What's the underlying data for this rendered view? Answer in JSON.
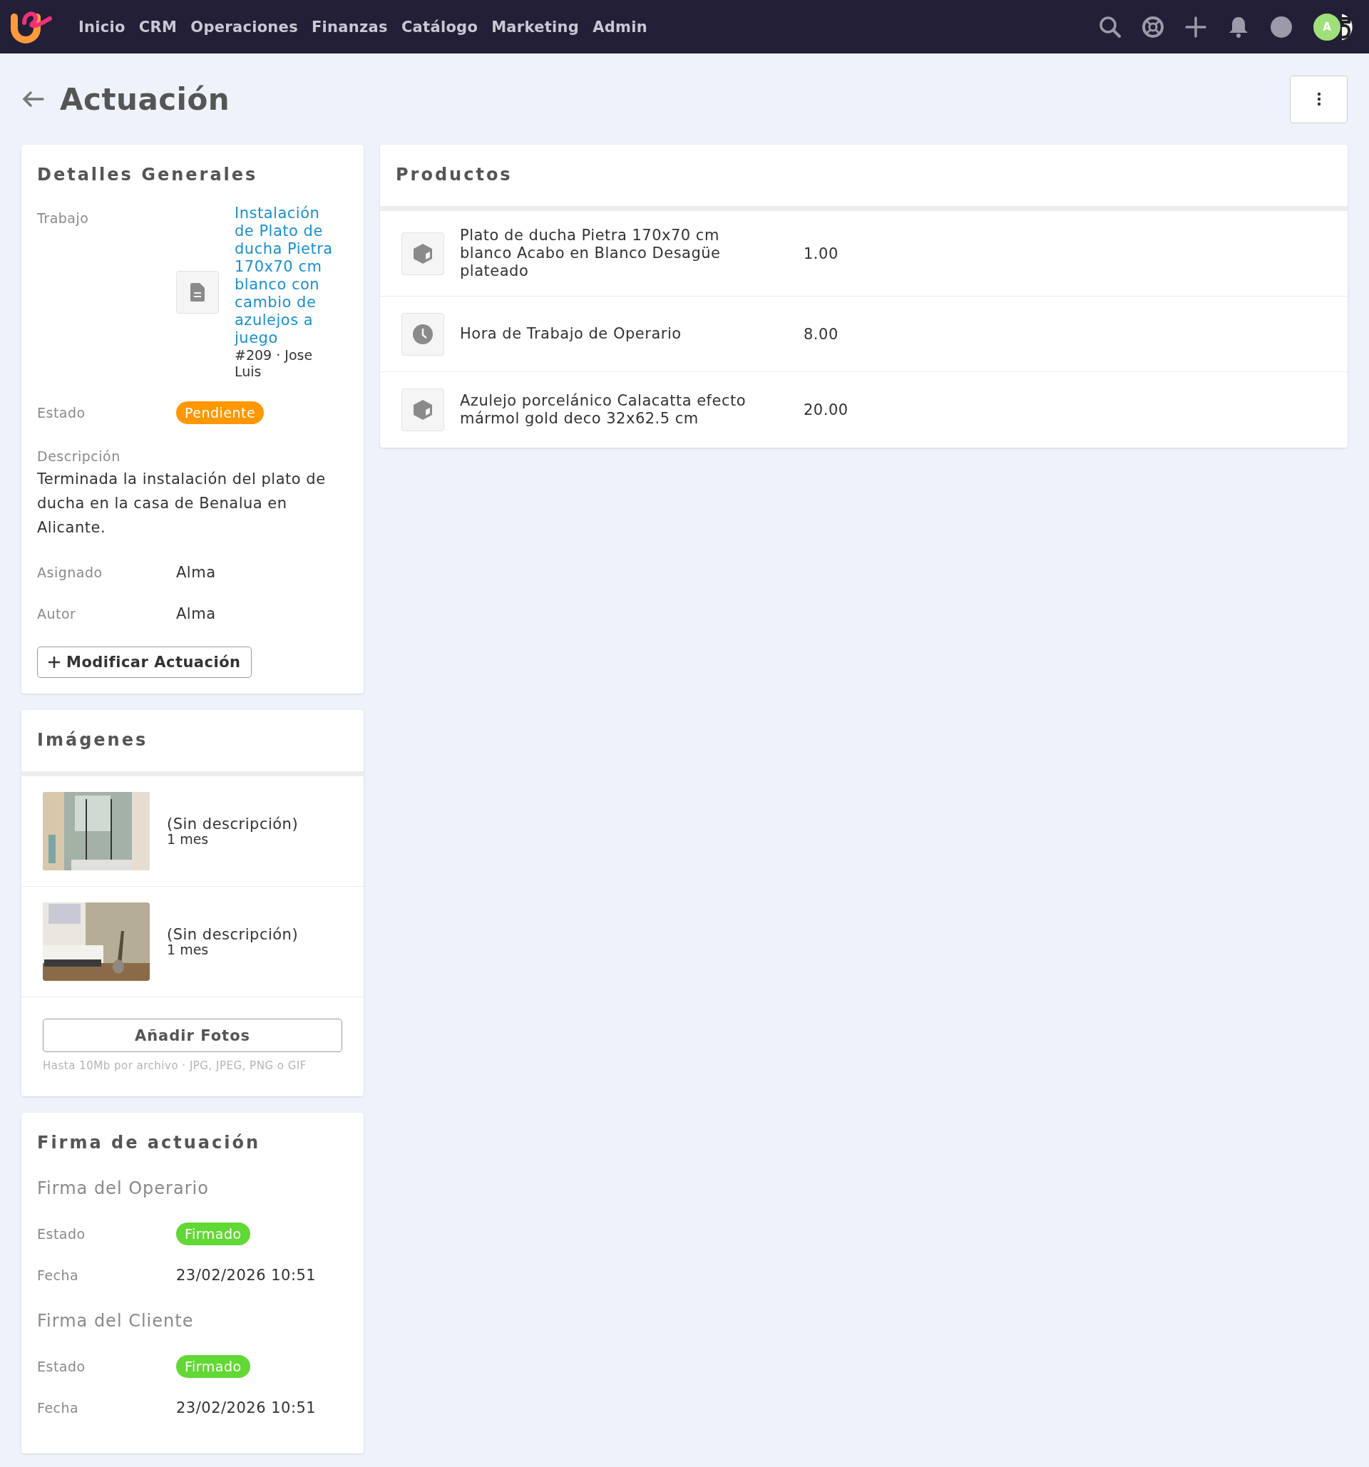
{
  "nav": {
    "items": [
      {
        "label": "Inicio"
      },
      {
        "label": "CRM"
      },
      {
        "label": "Operaciones"
      },
      {
        "label": "Finanzas"
      },
      {
        "label": "Catálogo"
      },
      {
        "label": "Marketing"
      },
      {
        "label": "Admin"
      }
    ],
    "avatar": "A"
  },
  "page": {
    "title": "Actuación"
  },
  "details": {
    "title": "Detalles Generales",
    "job": {
      "label": "Trabajo",
      "link": "Instalación de Plato de ducha Pietra 170x70 cm blanco con cambio de azulejos a juego",
      "meta": "#209 · Jose Luis"
    },
    "status": {
      "label": "Estado",
      "value": "Pendiente",
      "color": "#ff9800"
    },
    "description": {
      "label": "Descripción",
      "text": "Terminada la instalación del plato de ducha en la casa de Benalua en Alicante."
    },
    "fields": [
      {
        "label": "Asignado",
        "value": "Alma"
      },
      {
        "label": "Autor",
        "value": "Alma"
      }
    ],
    "button": "Modificar Actuación"
  },
  "images": {
    "title": "Imágenes",
    "items": [
      {
        "kind": "picture",
        "description": "(Sin descripción)",
        "age": "1 mes"
      },
      {
        "kind": "picture",
        "description": "(Sin descripción)",
        "age": "1 mes"
      }
    ],
    "button": "Añadir Fotos",
    "hint": "Hasta 10Mb por archivo · JPG, JPEG, PNG o GIF"
  },
  "signatures": {
    "title": "Firma de actuación",
    "groups": [
      {
        "title": "Firma del Operario",
        "status_label": "Estado",
        "status": "Firmado",
        "color": "#62d834",
        "date_label": "Fecha",
        "date": "23/02/2026 10:51"
      },
      {
        "title": "Firma del Cliente",
        "status_label": "Estado",
        "status": "Firmado",
        "color": "#62d834",
        "date_label": "Fecha",
        "date": "23/02/2026 10:51"
      }
    ]
  },
  "products": {
    "title": "Productos",
    "items": [
      {
        "kind": "product",
        "name": "Plato de ducha Pietra 170x70 cm blanco Acabo en Blanco Desagüe plateado",
        "quantity": "1.00"
      },
      {
        "kind": "service",
        "name": "Hora de Trabajo de Operario",
        "quantity": "8.00"
      },
      {
        "kind": "product",
        "name": "Azulejo porcelánico Calacatta efecto mármol gold deco 32x62.5 cm",
        "quantity": "20.00"
      }
    ]
  }
}
